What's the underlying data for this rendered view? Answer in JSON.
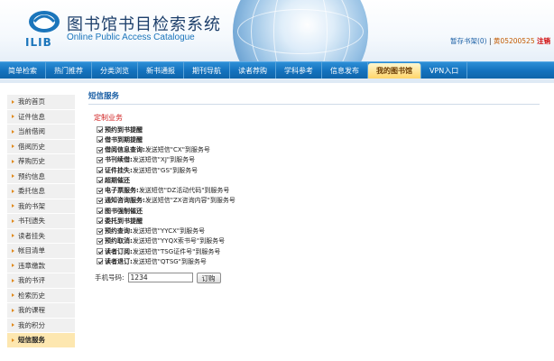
{
  "header": {
    "logo_text": "ILIB",
    "title_cn": "图书馆书目检索系统",
    "title_en": "Online Public Access Catalogue",
    "cart_label": "暂存书架(0)",
    "separator1": "|",
    "user_label": "黄05200525",
    "logout_label": "注销"
  },
  "nav": {
    "items": [
      {
        "label": "简单检索"
      },
      {
        "label": "热门推荐"
      },
      {
        "label": "分类浏览"
      },
      {
        "label": "新书通报"
      },
      {
        "label": "期刊导航"
      },
      {
        "label": "读者荐购"
      },
      {
        "label": "学科参考"
      },
      {
        "label": "信息发布"
      },
      {
        "label": "我的图书馆",
        "active": true
      },
      {
        "label": "VPN入口"
      }
    ]
  },
  "sidebar": {
    "items": [
      {
        "label": "我的首页"
      },
      {
        "label": "证件信息"
      },
      {
        "label": "当前借阅"
      },
      {
        "label": "借阅历史"
      },
      {
        "label": "荐购历史"
      },
      {
        "label": "预约信息"
      },
      {
        "label": "委托信息"
      },
      {
        "label": "我的书架"
      },
      {
        "label": "书刊遗失"
      },
      {
        "label": "读者挂失"
      },
      {
        "label": "帐目清单"
      },
      {
        "label": "违章缴款"
      },
      {
        "label": "我的书评"
      },
      {
        "label": "检索历史"
      },
      {
        "label": "我的课程"
      },
      {
        "label": "我的积分"
      },
      {
        "label": "短信服务",
        "active": true
      }
    ]
  },
  "main": {
    "page_title": "短信服务",
    "section_title": "定制业务",
    "options": [
      {
        "bold": "预约到书提醒",
        "text": "",
        "checked": true
      },
      {
        "bold": "借书到期提醒",
        "text": "",
        "checked": true
      },
      {
        "bold": "借阅信息查询:",
        "text": "发送短信\"CX\"到服务号",
        "checked": true
      },
      {
        "bold": "书刊续借:",
        "text": "发送短信\"XJ\"到服务号",
        "checked": true
      },
      {
        "bold": "证件挂失:",
        "text": "发送短信\"GS\"到服务号",
        "checked": true
      },
      {
        "bold": "超期催还",
        "text": "",
        "checked": true
      },
      {
        "bold": "电子票服务:",
        "text": "发送短信\"DZ活动代码\"到服务号",
        "checked": true
      },
      {
        "bold": "通知咨询服务:",
        "text": "发送短信\"ZX咨询内容\"到服务号",
        "checked": true
      },
      {
        "bold": "图书强制催还",
        "text": "",
        "checked": true
      },
      {
        "bold": "委托到书提醒",
        "text": "",
        "checked": true
      },
      {
        "bold": "预约查询:",
        "text": "发送短信\"YYCX\"到服务号",
        "checked": true
      },
      {
        "bold": "预约取消:",
        "text": "发送短信\"YYQX索书号\"到服务号",
        "checked": true
      },
      {
        "bold": "读者订阅:",
        "text": "发送短信\"TSG证件号\"到服务号",
        "checked": true
      },
      {
        "bold": "读者退订:",
        "text": "发送短信\"QTSG\"到服务号",
        "checked": true
      }
    ],
    "phone_label": "手机号码:",
    "phone_value": "1234",
    "subscribe_label": "订购"
  }
}
